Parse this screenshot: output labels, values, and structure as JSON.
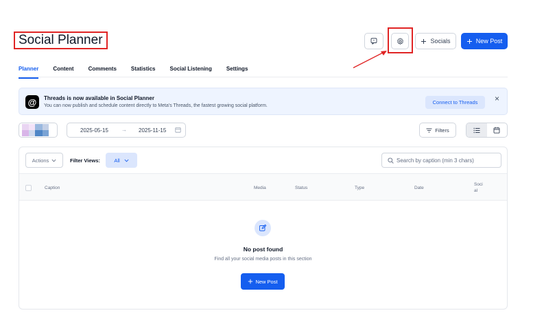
{
  "header": {
    "title": "Social Planner",
    "socials_label": "Socials",
    "new_post_label": "New Post"
  },
  "tabs": [
    {
      "label": "Planner",
      "active": true
    },
    {
      "label": "Content",
      "active": false
    },
    {
      "label": "Comments",
      "active": false
    },
    {
      "label": "Statistics",
      "active": false
    },
    {
      "label": "Social Listening",
      "active": false
    },
    {
      "label": "Settings",
      "active": false
    }
  ],
  "banner": {
    "title": "Threads is now available in Social Planner",
    "text": "You can now publish and schedule content directly to Meta's Threads, the fastest growing social platform.",
    "connect_label": "Connect to Threads",
    "close_icon": "×"
  },
  "toolbar": {
    "date_from": "2025-05-15",
    "date_to": "2025-11-15",
    "arrow": "→",
    "filters_label": "Filters"
  },
  "table_controls": {
    "actions_label": "Actions",
    "filter_views_label": "Filter Views:",
    "filter_view_value": "All",
    "search_placeholder": "Search by caption (min 3 chars)"
  },
  "table": {
    "columns": {
      "caption": "Caption",
      "media": "Media",
      "status": "Status",
      "type": "Type",
      "date": "Date",
      "social": "Soci\nal"
    }
  },
  "empty_state": {
    "title": "No post found",
    "subtitle": "Find all your social media posts in this section",
    "button_label": "New Post"
  },
  "colors": {
    "accent": "#155eef",
    "highlight_annotation": "#e02424"
  },
  "icons": {
    "feedback": "feedback-icon",
    "settings": "gear-icon",
    "plus": "plus-icon",
    "calendar": "calendar-icon",
    "filter": "filter-icon",
    "list_view": "list-view-icon",
    "calendar_view": "calendar-view-icon",
    "search": "search-icon",
    "edit": "edit-icon",
    "threads": "threads-logo"
  }
}
